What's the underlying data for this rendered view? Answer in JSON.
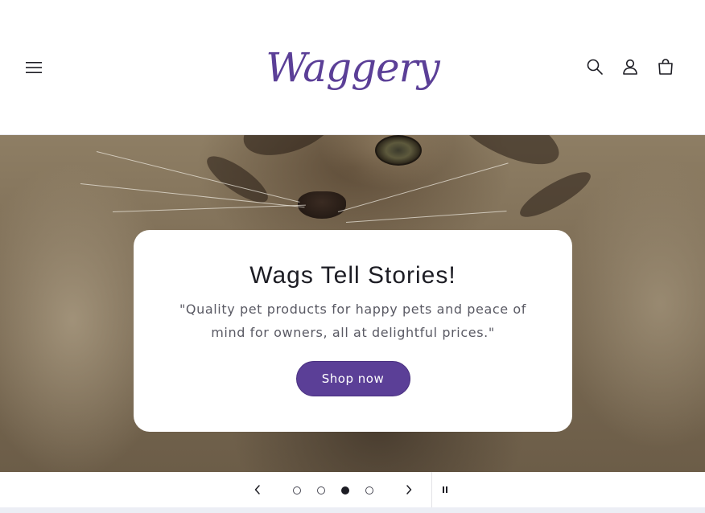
{
  "brand": {
    "logo_text": "Waggery",
    "color": "#5b3f97"
  },
  "header": {
    "icons": {
      "menu": "hamburger-menu-icon",
      "search": "search-icon",
      "account": "login-icon",
      "cart": "shopping-bag-icon"
    }
  },
  "hero": {
    "image": "tabby-kitten-photo",
    "title": "Wags Tell Stories!",
    "text": "\"Quality pet products for happy pets and peace of mind for owners, all at delightful prices.\"",
    "cta_label": "Shop now"
  },
  "slider": {
    "slides_count": 4,
    "active_slide": 3,
    "icons": {
      "previous": "chevron-left-icon",
      "next": "chevron-right-icon",
      "pause": "pause-icon"
    }
  }
}
